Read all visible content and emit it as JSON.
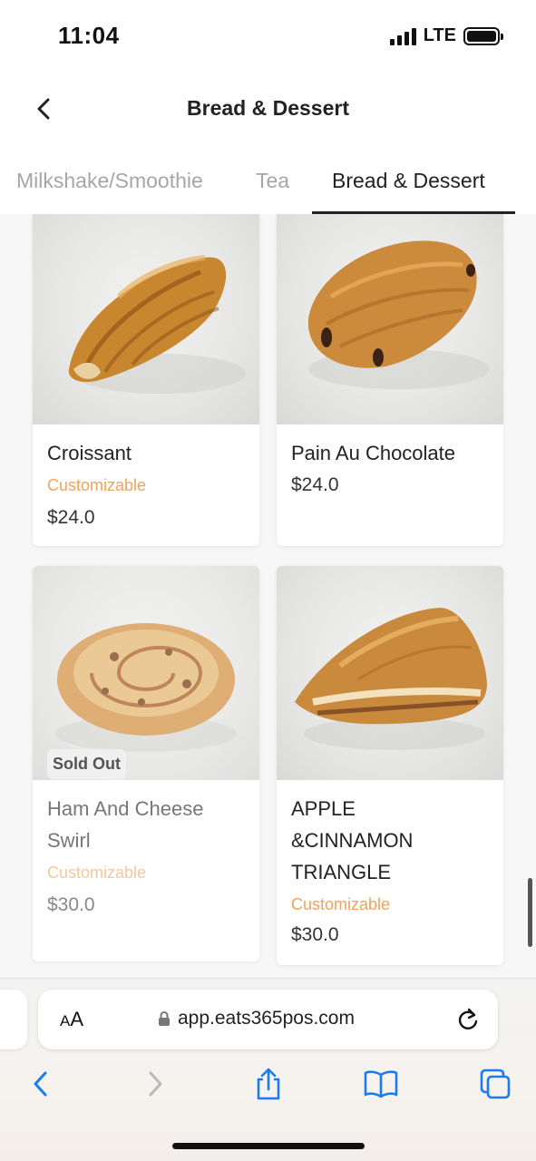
{
  "status_bar": {
    "time": "11:04",
    "network": "LTE"
  },
  "header": {
    "title": "Bread & Dessert"
  },
  "tabs": [
    {
      "label": "Milkshake/Smoothie"
    },
    {
      "label": "Tea"
    },
    {
      "label": "Bread & Dessert",
      "active": true
    }
  ],
  "products": [
    {
      "name": "Croissant",
      "tag": "Customizable",
      "price": "$24.0"
    },
    {
      "name": "Pain Au Chocolate",
      "price": "$24.0"
    },
    {
      "name_lines": [
        "Ham And Cheese",
        "Swirl"
      ],
      "tag": "Customizable",
      "price": "$30.0",
      "badge": "Sold Out"
    },
    {
      "name_lines": [
        "APPLE",
        "&CINNAMON",
        "TRIANGLE"
      ],
      "tag": "Customizable",
      "price": "$30.0"
    }
  ],
  "browser": {
    "text_size_label": "AA",
    "url": "app.eats365pos.com"
  },
  "colors": {
    "tag_orange": "#f0a35a",
    "text_dark": "#222222",
    "tab_inactive": "#a6a6a6",
    "browser_blue": "#1a7cf0"
  }
}
